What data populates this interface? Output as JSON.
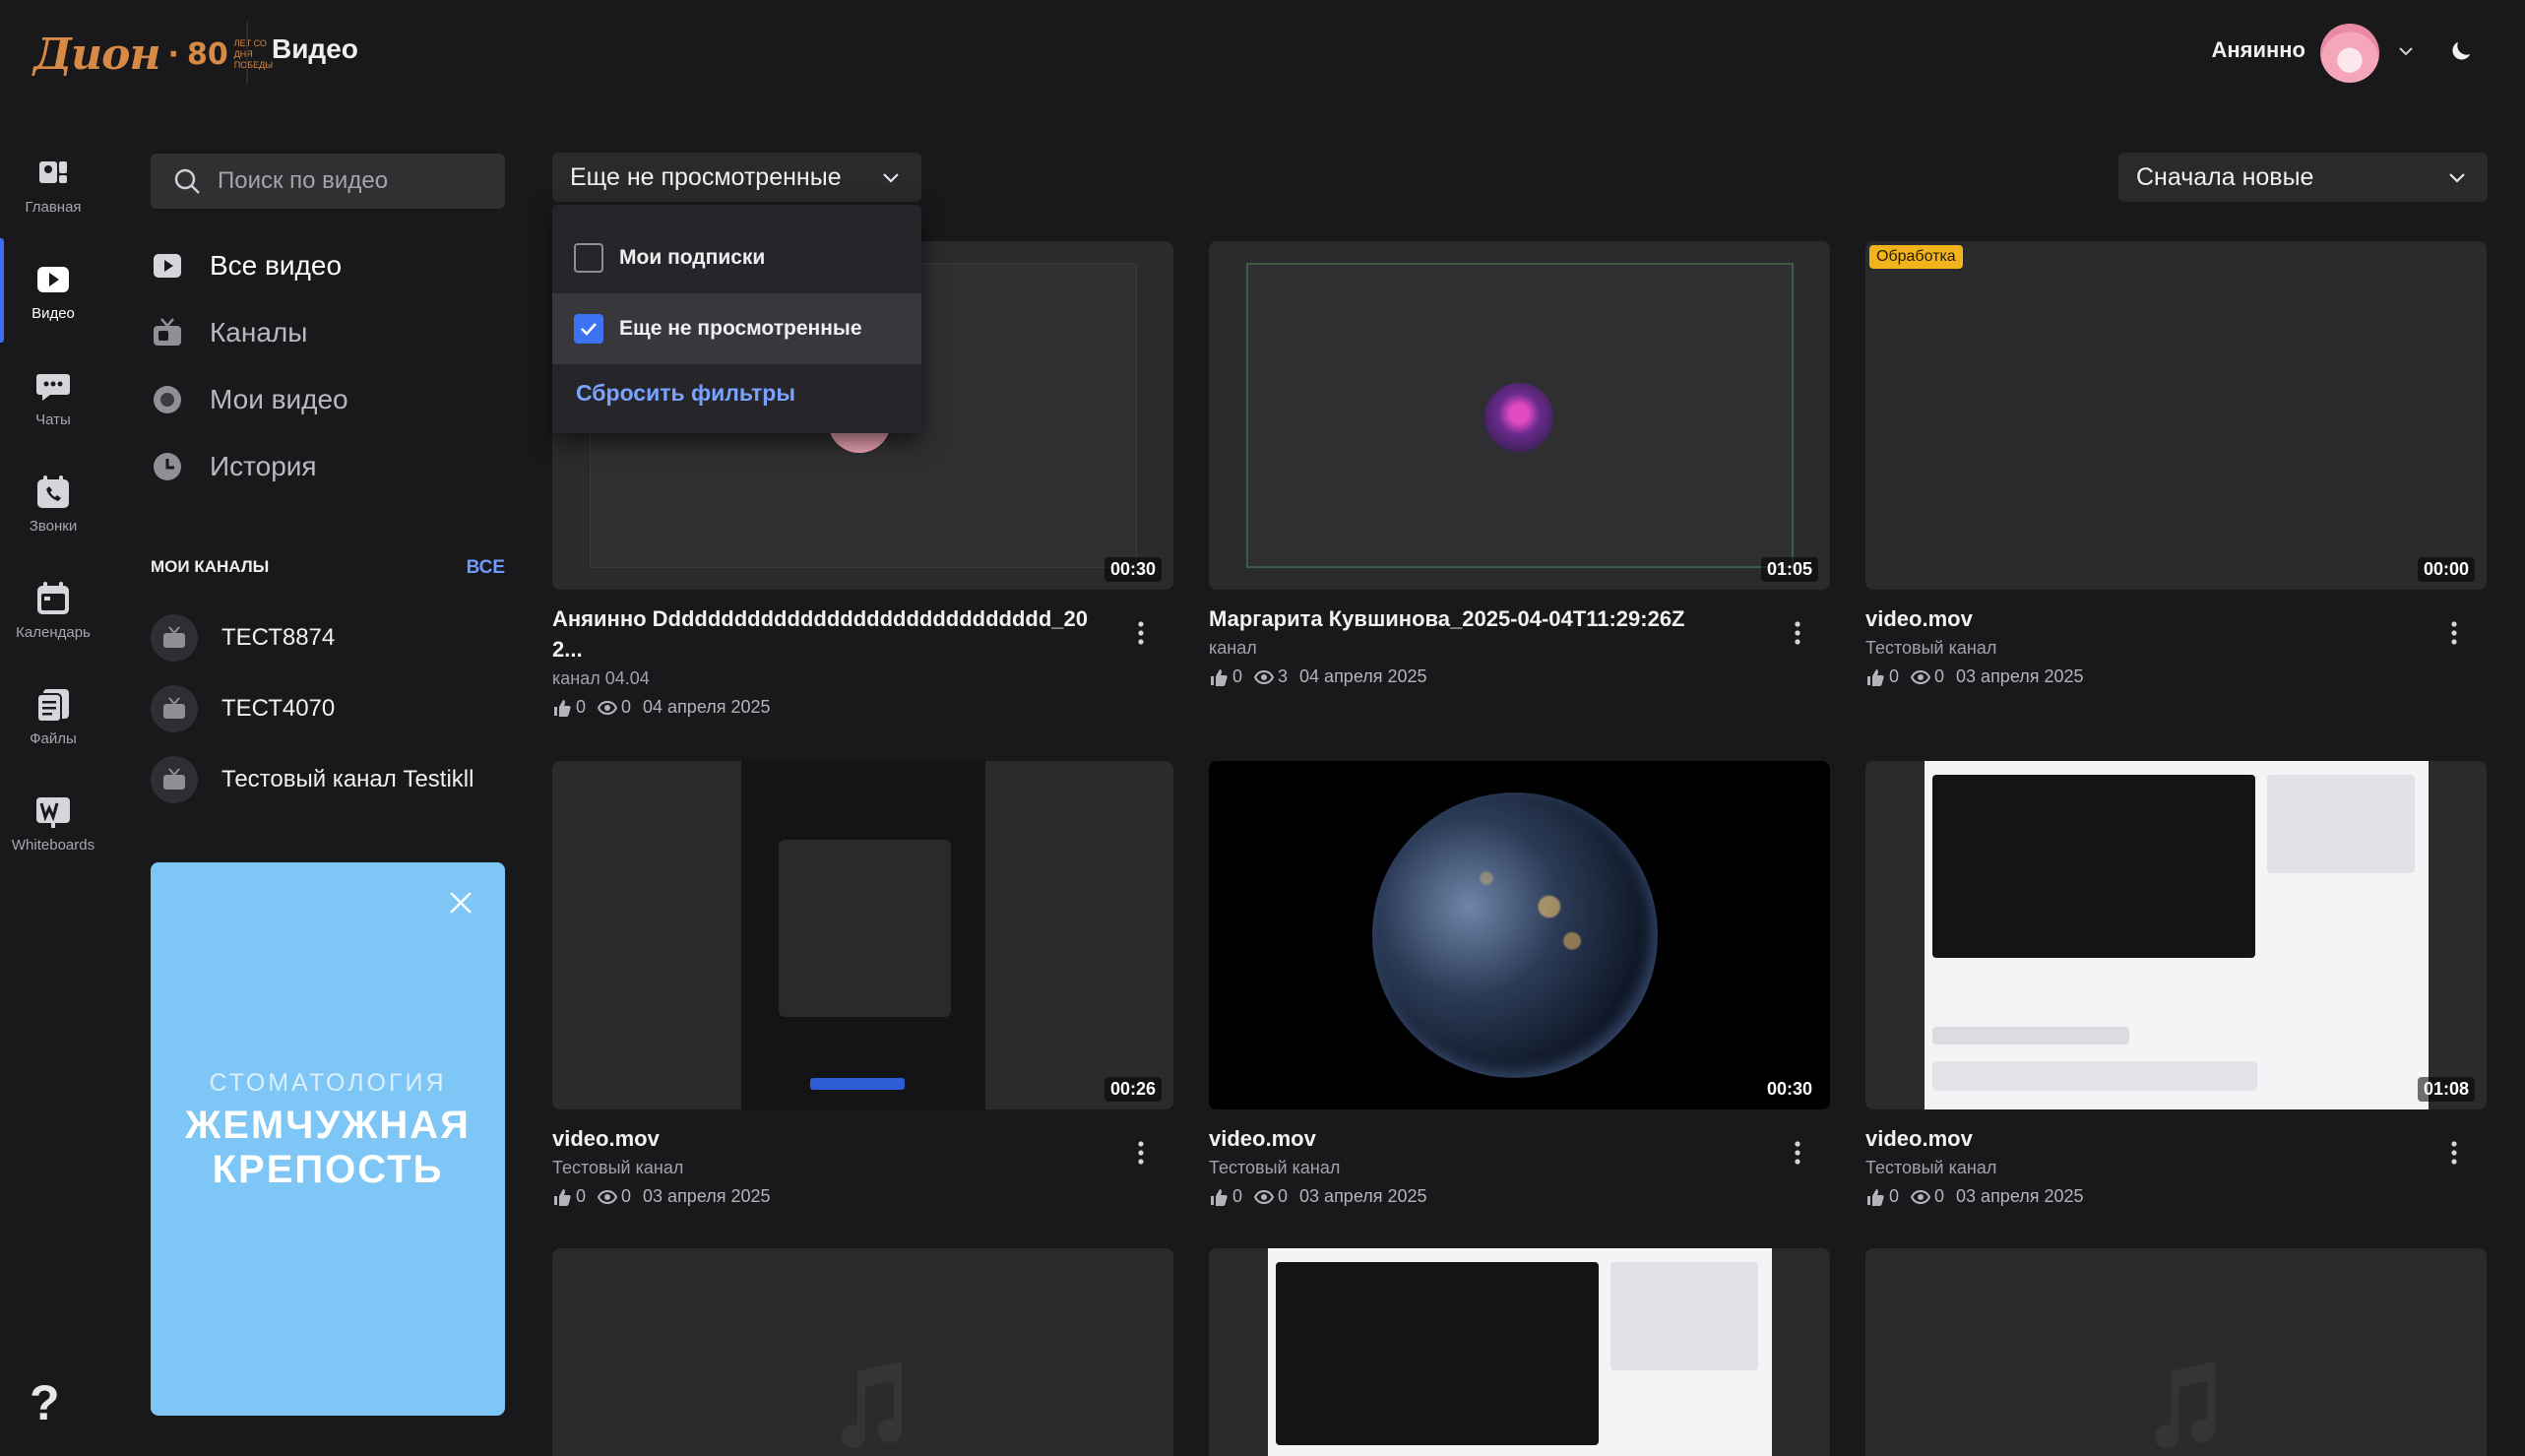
{
  "header": {
    "logo": {
      "word": "Дион",
      "dot": "·",
      "number": "80",
      "tagline": "ЛЕТ СО ДНЯ ПОБЕДЫ"
    },
    "title": "Видео",
    "user_name": "Аняинно"
  },
  "rail": {
    "items": [
      {
        "label": "Главная",
        "icon": "home-icon"
      },
      {
        "label": "Видео",
        "icon": "video-play-icon",
        "active": true
      },
      {
        "label": "Чаты",
        "icon": "chat-icon"
      },
      {
        "label": "Звонки",
        "icon": "phone-icon"
      },
      {
        "label": "Календарь",
        "icon": "calendar-icon"
      },
      {
        "label": "Файлы",
        "icon": "files-icon"
      },
      {
        "label": "Whiteboards",
        "icon": "whiteboard-icon"
      }
    ],
    "help": "?"
  },
  "sidebar": {
    "search_placeholder": "Поиск по видео",
    "nav": [
      {
        "label": "Все видео",
        "icon": "play-square-icon",
        "active": true
      },
      {
        "label": "Каналы",
        "icon": "tv-icon"
      },
      {
        "label": "Мои видео",
        "icon": "record-icon"
      },
      {
        "label": "История",
        "icon": "clock-icon"
      }
    ],
    "channels_title": "МОИ КАНАЛЫ",
    "channels_all": "ВСЕ",
    "channels": [
      {
        "name": "ТЕСТ8874"
      },
      {
        "name": "ТЕСТ4070"
      },
      {
        "name": "Тестовый канал Testikll"
      }
    ],
    "promo": {
      "line1": "СТОМАТОЛОГИЯ",
      "line2": "ЖЕМЧУЖНАЯ",
      "line3": "КРЕПОСТЬ"
    }
  },
  "filters": {
    "selected": "Еще не просмотренные",
    "options": [
      {
        "label": "Мои подписки",
        "checked": false
      },
      {
        "label": "Еще не просмотренные",
        "checked": true
      }
    ],
    "reset": "Сбросить фильтры",
    "sort": "Сначала новые"
  },
  "videos": [
    {
      "title": "Аняинно Dddddddddddddddddddddddddddddd_202...",
      "channel": "канал 04.04",
      "likes": "0",
      "views": "0",
      "date": "04 апреля 2025",
      "duration": "00:30"
    },
    {
      "title": "Маргарита Кувшинова_2025-04-04T11:29:26Z",
      "channel": "канал",
      "likes": "0",
      "views": "3",
      "date": "04 апреля 2025",
      "duration": "01:05"
    },
    {
      "title": "video.mov",
      "channel": "Тестовый канал",
      "likes": "0",
      "views": "0",
      "date": "03 апреля 2025",
      "duration": "00:00",
      "badge": "Обработка"
    },
    {
      "title": "video.mov",
      "channel": "Тестовый канал",
      "likes": "0",
      "views": "0",
      "date": "03 апреля 2025",
      "duration": "00:26"
    },
    {
      "title": "video.mov",
      "channel": "Тестовый канал",
      "likes": "0",
      "views": "0",
      "date": "03 апреля 2025",
      "duration": "00:30"
    },
    {
      "title": "video.mov",
      "channel": "Тестовый канал",
      "likes": "0",
      "views": "0",
      "date": "03 апреля 2025",
      "duration": "01:08"
    }
  ]
}
